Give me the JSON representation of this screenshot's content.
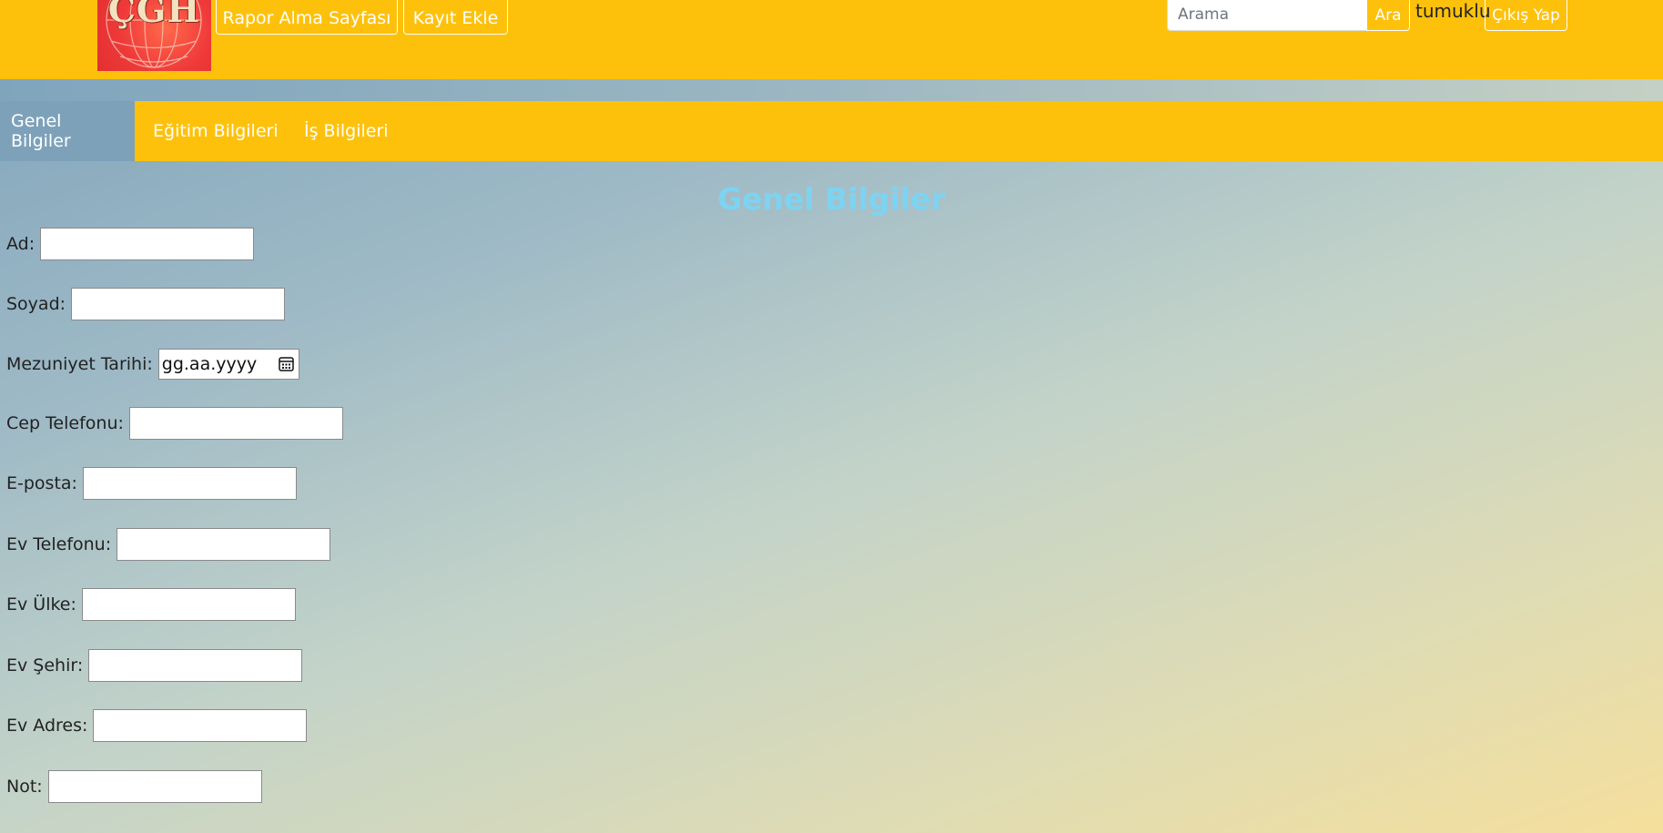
{
  "header": {
    "logo_text": "ÇGH",
    "nav": [
      "Rapor Alma Sayfası",
      "Kayıt Ekle"
    ],
    "search": {
      "placeholder": "Arama",
      "button": "Ara"
    },
    "username": "tumuklu",
    "logout": "Çıkış Yap"
  },
  "tabs": [
    {
      "label": "Genel Bilgiler",
      "active": true
    },
    {
      "label": "Eğitim Bilgileri",
      "active": false
    },
    {
      "label": "İş Bilgileri",
      "active": false
    }
  ],
  "form": {
    "title": "Genel Bilgiler",
    "fields": [
      {
        "label": "Ad:",
        "value": ""
      },
      {
        "label": "Soyad:",
        "value": ""
      },
      {
        "label": "Mezuniyet Tarihi:",
        "value": "",
        "placeholder": "gg.aa.yyyy"
      },
      {
        "label": "Cep Telefonu:",
        "value": ""
      },
      {
        "label": "E-posta:",
        "value": ""
      },
      {
        "label": "Ev Telefonu:",
        "value": ""
      },
      {
        "label": "Ev Ülke:",
        "value": ""
      },
      {
        "label": "Ev Şehir:",
        "value": ""
      },
      {
        "label": "Ev Adres:",
        "value": ""
      },
      {
        "label": "Not:",
        "value": ""
      }
    ]
  },
  "icons": {
    "calendar": "calendar-icon"
  },
  "colors": {
    "header_bg": "#fec10b",
    "active_tab_bg": "#7ea1ba",
    "title": "#7dd3f2",
    "logo": "#f03a3a"
  }
}
